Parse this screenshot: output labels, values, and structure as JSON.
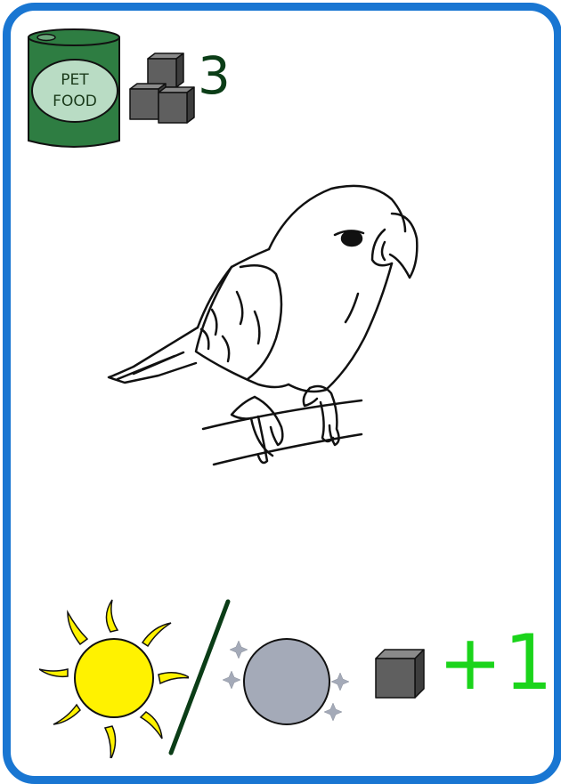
{
  "card": {
    "border_color": "#1976d2",
    "cost": {
      "item_icon": "pet-food-can-icon",
      "item_label_line1": "PET",
      "item_label_line2": "FOOD",
      "resource_icon": "cube-stack-icon",
      "amount": "3"
    },
    "illustration": {
      "icon": "parrot-on-branch-illustration"
    },
    "reward": {
      "day_icon": "sun-icon",
      "night_icon": "moon-icon",
      "resource_icon": "cube-icon",
      "amount": "+1"
    },
    "colors": {
      "can_green": "#2e7d42",
      "can_label": "#b9dcc4",
      "cube_gray": "#5f5f5f",
      "sun_yellow": "#fff200",
      "moon_gray": "#a4aab8",
      "reward_green": "#1bd41b",
      "cost_text": "#0b3d17"
    }
  }
}
